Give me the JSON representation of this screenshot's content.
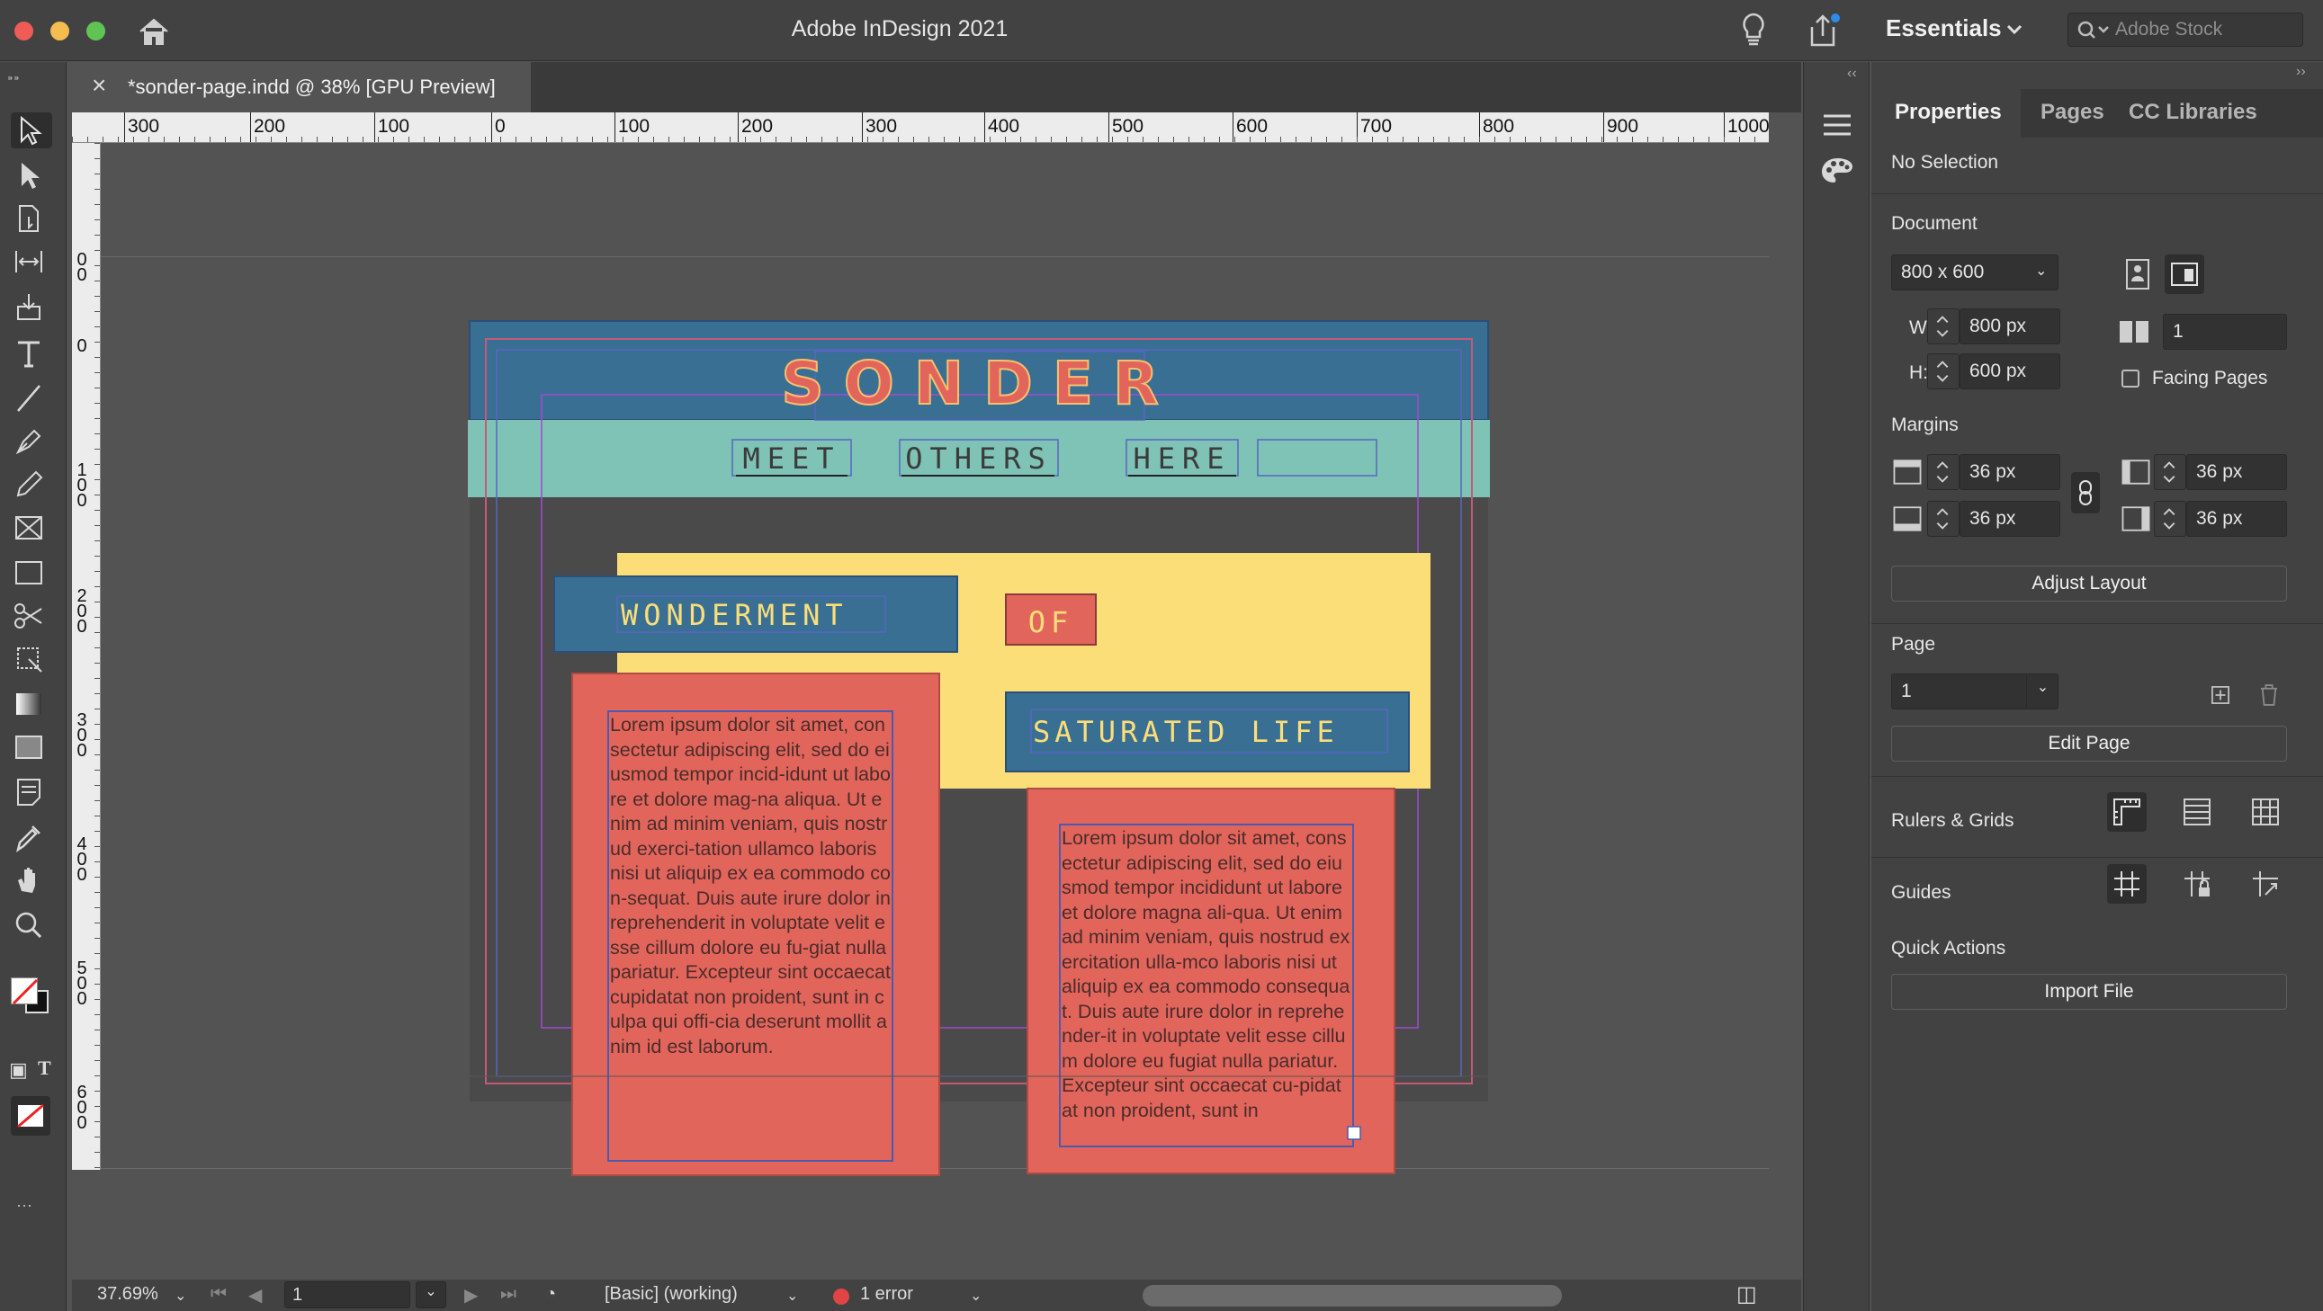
{
  "window": {
    "title": "Adobe InDesign 2021"
  },
  "topbar": {
    "workspace": "Essentials",
    "search_placeholder": "Adobe Stock"
  },
  "document_tab": {
    "title": "*sonder-page.indd @ 38% [GPU Preview]"
  },
  "ruler_h": [
    "300",
    "200",
    "100",
    "0",
    "100",
    "200",
    "300",
    "400",
    "500",
    "600",
    "700",
    "800",
    "900",
    "1000"
  ],
  "ruler_v": [
    "0",
    "100",
    "200",
    "300",
    "400",
    "500",
    "600"
  ],
  "ruler_v_top": "0",
  "design": {
    "title": "SONDER",
    "nav": [
      "MEET",
      "OTHERS",
      "HERE"
    ],
    "heading_1": "WONDERMENT",
    "heading_2": "OF",
    "heading_3": "SATURATED LIFE",
    "body_left": "Lorem ipsum dolor sit amet, consectetur adipiscing elit, sed do eiusmod tempor incid-idunt ut labore et dolore mag-na aliqua. Ut enim ad minim veniam, quis nostrud exerci-tation ullamco laboris nisi ut aliquip ex ea commodo con-sequat. Duis aute irure dolor in reprehenderit in voluptate velit esse cillum dolore eu fu-giat nulla pariatur. Excepteur sint occaecat cupidatat non proident, sunt in culpa qui offi-cia deserunt mollit anim id est laborum.",
    "body_right": "Lorem ipsum dolor sit amet, consectetur adipiscing elit, sed do eiusmod tempor incididunt ut labore et dolore magna ali-qua. Ut enim ad minim veniam, quis nostrud exercitation ulla-mco laboris nisi ut aliquip ex ea commodo consequat. Duis aute irure dolor in reprehender-it in voluptate velit esse cillum dolore eu fugiat nulla pariatur. Excepteur sint occaecat cu-pidatat non proident, sunt in",
    "colors": {
      "blue": "#3a6f94",
      "teal": "#7fc2b6",
      "yellow": "#fcde79",
      "coral": "#e2655c",
      "dark": "#4a4a4a"
    }
  },
  "statusbar": {
    "zoom": "37.69%",
    "page": "1",
    "preflight_profile": "[Basic] (working)",
    "errors": "1 error"
  },
  "properties": {
    "tabs": [
      "Properties",
      "Pages",
      "CC Libraries"
    ],
    "selection": "No Selection",
    "document_label": "Document",
    "preset": "800 x 600",
    "width_label": "W:",
    "width": "800 px",
    "height_label": "H:",
    "height": "600 px",
    "pages_count": "1",
    "facing_pages": "Facing Pages",
    "margins_label": "Margins",
    "margin_top": "36 px",
    "margin_bottom": "36 px",
    "margin_inside": "36 px",
    "margin_outside": "36 px",
    "adjust_layout": "Adjust Layout",
    "page_label": "Page",
    "page_value": "1",
    "edit_page": "Edit Page",
    "rulers_grids": "Rulers & Grids",
    "guides": "Guides",
    "quick_actions": "Quick Actions",
    "import_file": "Import File"
  }
}
